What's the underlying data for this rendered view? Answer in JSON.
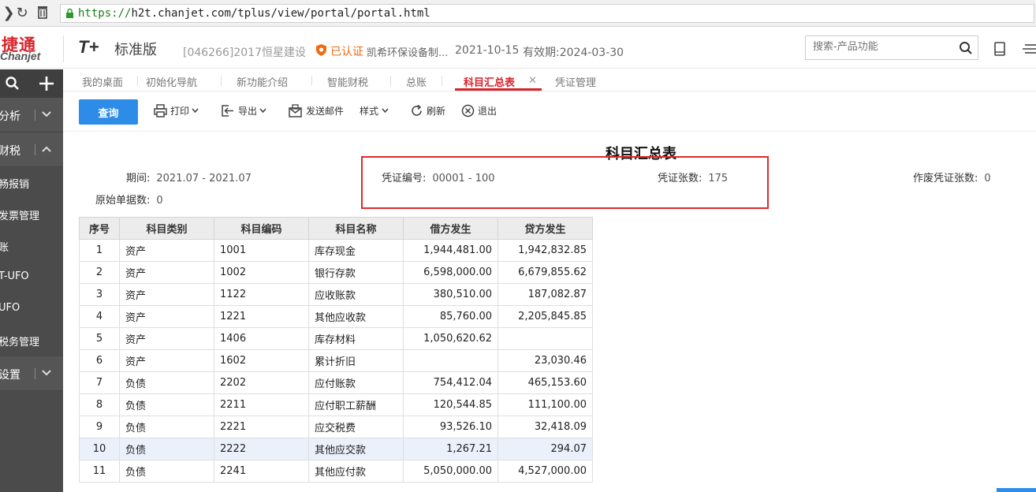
{
  "browser": {
    "url_proto": "https://",
    "url_rest": "h2t.chanjet.com/tplus/view/portal/portal.html"
  },
  "header": {
    "logo_cn": "捷通",
    "logo_en": "Chanjet",
    "product": "T+",
    "edition": "标准版",
    "account": "[046266]2017恒星建设",
    "certified": "已认证",
    "company": "凯希环保设备制...",
    "date": "2021-10-15",
    "validity": "有效期:2024-03-30",
    "search_placeholder": "搜索-产品功能"
  },
  "sidebar": {
    "groups": [
      {
        "label": "分析"
      },
      {
        "label": "财税"
      },
      {
        "label": "设置"
      }
    ],
    "items": [
      {
        "label": "畅报销"
      },
      {
        "label": "发票管理"
      },
      {
        "label": "账"
      },
      {
        "label": "T-UFO"
      },
      {
        "label": "UFO"
      },
      {
        "label": "税务管理"
      }
    ]
  },
  "tabs": [
    {
      "label": "我的桌面"
    },
    {
      "label": "初始化导航"
    },
    {
      "label": "新功能介绍"
    },
    {
      "label": "智能财税"
    },
    {
      "label": "总账"
    },
    {
      "label": "科目汇总表"
    },
    {
      "label": "凭证管理"
    }
  ],
  "toolbar": {
    "query": "查询",
    "print": "打印",
    "export": "导出",
    "email": "发送邮件",
    "style": "样式",
    "refresh": "刷新",
    "exit": "退出"
  },
  "report": {
    "title": "科目汇总表",
    "period_label": "期间:",
    "period_value": "2021.07 - 2021.07",
    "voucher_no_label": "凭证编号:",
    "voucher_no_value": "00001 - 100",
    "voucher_count_label": "凭证张数:",
    "voucher_count_value": "175",
    "void_count_label": "作废凭证张数:",
    "void_count_value": "0",
    "orig_count_label": "原始单据数:",
    "orig_count_value": "0",
    "columns": [
      "序号",
      "科目类别",
      "科目编码",
      "科目名称",
      "借方发生",
      "贷方发生"
    ],
    "rows": [
      {
        "no": "1",
        "cat": "资产",
        "code": "1001",
        "name": "库存现金",
        "dr": "1,944,481.00",
        "cr": "1,942,832.85"
      },
      {
        "no": "2",
        "cat": "资产",
        "code": "1002",
        "name": "银行存款",
        "dr": "6,598,000.00",
        "cr": "6,679,855.62"
      },
      {
        "no": "3",
        "cat": "资产",
        "code": "1122",
        "name": "应收账款",
        "dr": "380,510.00",
        "cr": "187,082.87"
      },
      {
        "no": "4",
        "cat": "资产",
        "code": "1221",
        "name": "其他应收款",
        "dr": "85,760.00",
        "cr": "2,205,845.85"
      },
      {
        "no": "5",
        "cat": "资产",
        "code": "1406",
        "name": "库存材料",
        "dr": "1,050,620.62",
        "cr": ""
      },
      {
        "no": "6",
        "cat": "资产",
        "code": "1602",
        "name": "累计折旧",
        "dr": "",
        "cr": "23,030.46"
      },
      {
        "no": "7",
        "cat": "负债",
        "code": "2202",
        "name": "应付账款",
        "dr": "754,412.04",
        "cr": "465,153.60"
      },
      {
        "no": "8",
        "cat": "负债",
        "code": "2211",
        "name": "应付职工薪酬",
        "dr": "120,544.85",
        "cr": "111,100.00"
      },
      {
        "no": "9",
        "cat": "负债",
        "code": "2221",
        "name": "应交税费",
        "dr": "93,526.10",
        "cr": "32,418.09"
      },
      {
        "no": "10",
        "cat": "负债",
        "code": "2222",
        "name": "其他应交款",
        "dr": "1,267.21",
        "cr": "294.07"
      },
      {
        "no": "11",
        "cat": "负债",
        "code": "2241",
        "name": "其他应付款",
        "dr": "5,050,000.00",
        "cr": "4,527,000.00"
      }
    ]
  },
  "colors": {
    "brand_red": "#d8232a",
    "primary_blue": "#2d8ce8",
    "sidebar_bg": "#4b4b4b",
    "highlight_box": "#e12a2a"
  }
}
